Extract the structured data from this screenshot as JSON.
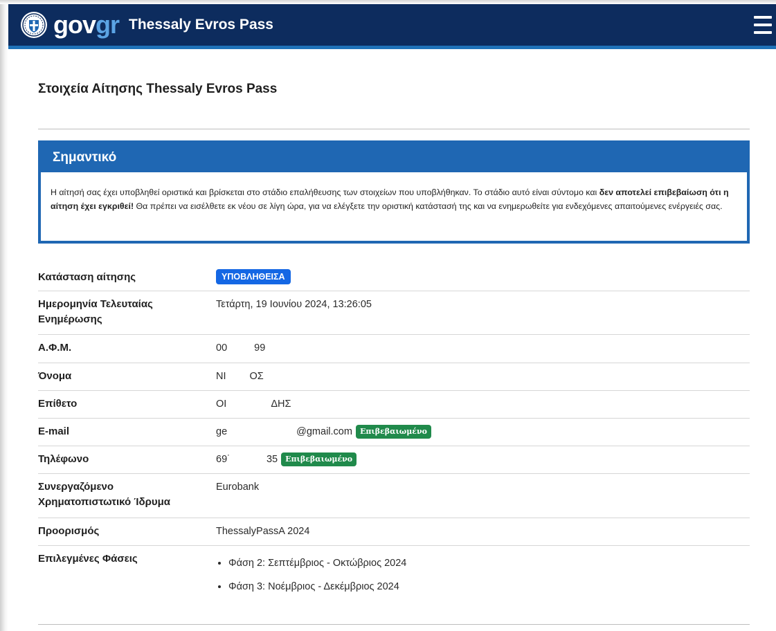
{
  "header": {
    "logo_gov": "gov",
    "logo_gr": "gr",
    "app_title": "Thessaly Evros Pass"
  },
  "page_title": "Στοιχεία Αίτησης Thessaly Evros Pass",
  "notice": {
    "title": "Σημαντικό",
    "text_1": "Η αίτησή σας έχει υποβληθεί οριστικά και βρίσκεται στο στάδιο επαλήθευσης των στοιχείων που υποβλήθηκαν. Το στάδιο αυτό είναι σύντομο και ",
    "text_bold": "δεν αποτελεί επιβεβαίωση ότι η αίτηση έχει εγκριθεί!",
    "text_2": " Θα πρέπει να εισέλθετε εκ νέου σε λίγη ώρα, για να ελέγξετε την οριστική κατάστασή της και να ενημερωθείτε για ενδεχόμενες απαιτούμενες ενέργειές σας."
  },
  "details": {
    "status": {
      "label": "Κατάσταση αίτησης",
      "value": "ΥΠΟΒΛΗΘΕΙΣΑ"
    },
    "last_update": {
      "label": "Ημερομηνία Τελευταίας Ενημέρωσης",
      "value": "Τετάρτη, 19 Ιουνίου 2024, 13:26:05"
    },
    "afm": {
      "label": "Α.Φ.Μ.",
      "value_start": "00",
      "value_end": "99"
    },
    "first_name": {
      "label": "Όνομα",
      "value_start": "ΝΙ",
      "value_end": "ΟΣ"
    },
    "last_name": {
      "label": "Επίθετο",
      "value_start": "ΟΙ",
      "value_end": "ΔΗΣ"
    },
    "email": {
      "label": "E-mail",
      "value_start": "ge",
      "value_end": "@gmail.com",
      "badge": "Επιβεβαιωμένο"
    },
    "phone": {
      "label": "Τηλέφωνο",
      "value_start": "69˙",
      "value_end": "35",
      "badge": "Επιβεβαιωμένο"
    },
    "bank": {
      "label": "Συνεργαζόμενο Χρηματοπιστωτικό Ίδρυμα",
      "value": "Eurobank"
    },
    "destination": {
      "label": "Προορισμός",
      "value": "ThessalyPassA 2024"
    },
    "phases": {
      "label": "Επιλεγμένες Φάσεις",
      "items": [
        "Φάση 2: Σεπτέμβριος - Οκτώβριος 2024",
        "Φάση 3: Νοέμβριος - Δεκέμβριος 2024"
      ]
    }
  },
  "colors": {
    "header_bg": "#0d2c5e",
    "accent_blue": "#1f67b3",
    "status_blue": "#1467e4",
    "verified_green": "#208a4b"
  },
  "icons": {
    "emblem": "greek-state-emblem-icon",
    "menu": "hamburger-menu-icon"
  }
}
